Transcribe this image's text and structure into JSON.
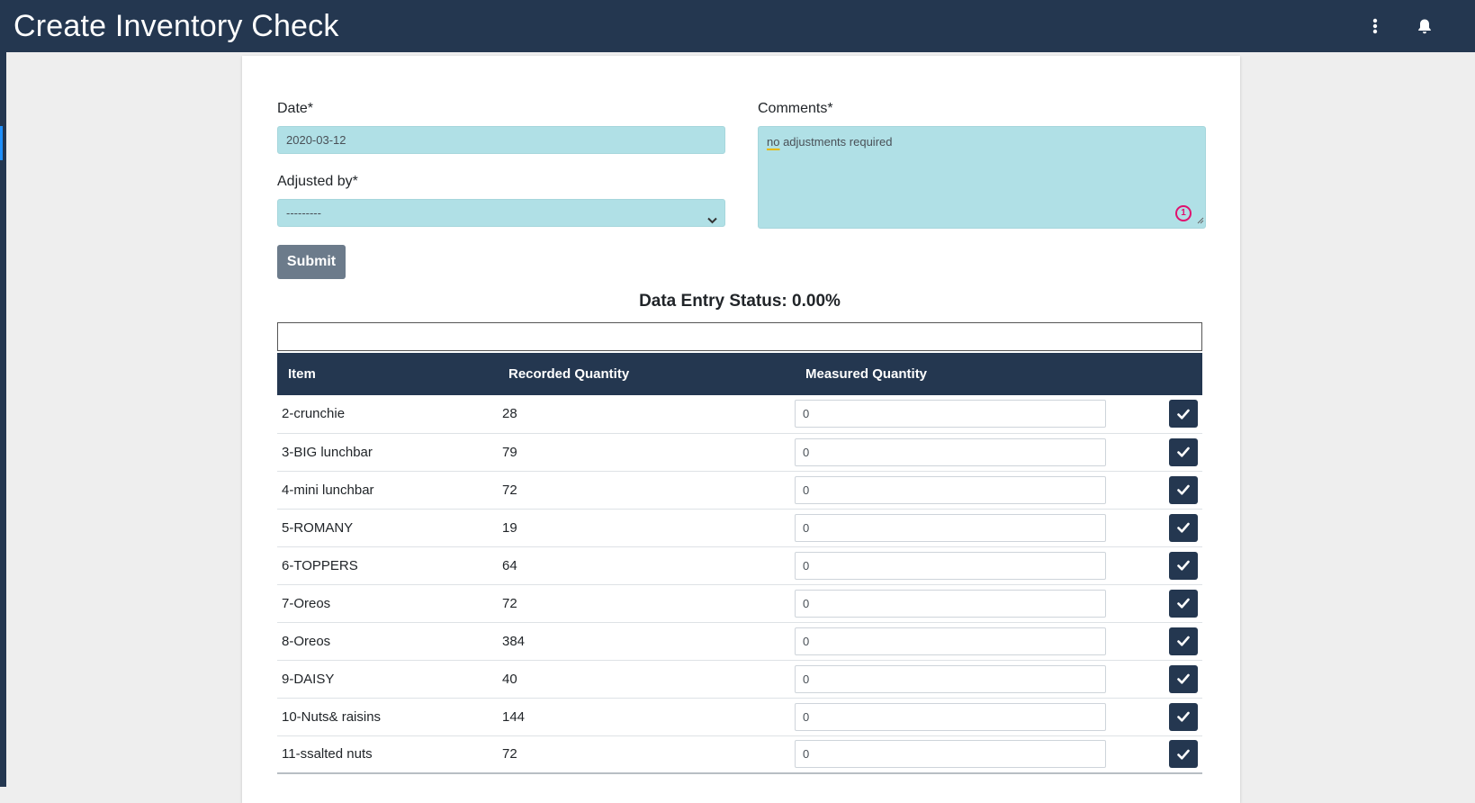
{
  "colors": {
    "navbar": "#243750",
    "field_bg": "#b0e0e6",
    "submit_bg": "#6c7b8b",
    "header_bg": "#243750"
  },
  "header": {
    "title": "Create Inventory Check",
    "icons": [
      "more-vertical-icon",
      "bell-icon"
    ]
  },
  "form": {
    "date_label": "Date*",
    "date_value": "2020-03-12",
    "adjusted_label": "Adjusted by*",
    "adjusted_value": "---------",
    "comments_label": "Comments*",
    "comments_first_word": "no",
    "comments_rest": " adjustments required",
    "grammar_count": "1",
    "submit_label": "Submit"
  },
  "status": {
    "label": "Data Entry Status: 0.00%",
    "progress_fraction": 0.0
  },
  "table": {
    "columns": [
      "Item",
      "Recorded Quantity",
      "Measured Quantity"
    ],
    "rows": [
      {
        "item": "2-crunchie",
        "recorded": "28",
        "measured": "0"
      },
      {
        "item": "3-BIG lunchbar",
        "recorded": "79",
        "measured": "0"
      },
      {
        "item": "4-mini lunchbar",
        "recorded": "72",
        "measured": "0"
      },
      {
        "item": "5-ROMANY",
        "recorded": "19",
        "measured": "0"
      },
      {
        "item": "6-TOPPERS",
        "recorded": "64",
        "measured": "0"
      },
      {
        "item": "7-Oreos",
        "recorded": "72",
        "measured": "0"
      },
      {
        "item": "8-Oreos",
        "recorded": "384",
        "measured": "0"
      },
      {
        "item": "9-DAISY",
        "recorded": "40",
        "measured": "0"
      },
      {
        "item": "10-Nuts& raisins",
        "recorded": "144",
        "measured": "0"
      },
      {
        "item": "11-ssalted nuts",
        "recorded": "72",
        "measured": "0"
      }
    ]
  }
}
